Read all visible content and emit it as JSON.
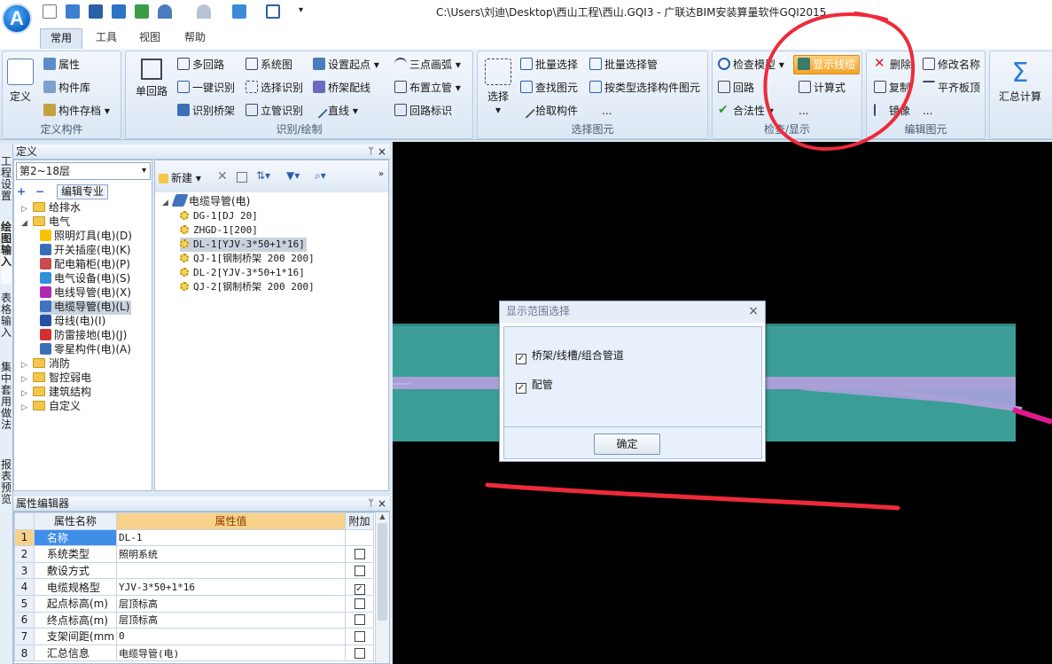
{
  "app": {
    "logo": "A",
    "title": "C:\\Users\\刘迪\\Desktop\\西山工程\\西山.GQI3 - 广联达BIM安装算量软件GQI2015"
  },
  "quick_access": {
    "overflow": "▾"
  },
  "tabs": [
    "常用",
    "工具",
    "视图",
    "帮助"
  ],
  "ribbon": {
    "define": {
      "group": "定义构件",
      "big": "定义",
      "items": [
        "属性",
        "构件库",
        "构件存档"
      ]
    },
    "draw": {
      "group": "识别/绘制",
      "big": "单回路",
      "col1": [
        "多回路",
        "一键识别",
        "识别桥架"
      ],
      "col2": [
        "系统图",
        "选择识别",
        "立管识别"
      ],
      "col3": [
        "设置起点",
        "桥架配线",
        "直线"
      ],
      "col4": [
        "三点画弧",
        "布置立管",
        "回路标识"
      ]
    },
    "select": {
      "group": "选择图元",
      "big": "选择",
      "col1": [
        "批量选择",
        "查找图元",
        "拾取构件"
      ],
      "col2": [
        "批量选择管",
        "按类型选择构件图元"
      ],
      "more": "..."
    },
    "check": {
      "group": "检查/显示",
      "col1": [
        "检查模型",
        "回路",
        "合法性"
      ],
      "col2": [
        "显示线缆",
        "计算式"
      ],
      "more": "..."
    },
    "edit": {
      "group": "编辑图元",
      "col1": [
        "删除",
        "复制",
        "镜像"
      ],
      "col2": [
        "修改名称",
        "平齐板顶"
      ],
      "more": "..."
    },
    "sum": {
      "big": "汇总计算"
    }
  },
  "vtabs": [
    "工程设置",
    "绘图输入",
    "表格输入",
    "集中套用做法",
    "报表预览"
  ],
  "define_panel": {
    "title": "定义",
    "floor": "第2~18层",
    "edit_major": "编辑专业",
    "tree": [
      {
        "label": "给排水",
        "level": 0,
        "type": "folder",
        "exp": "▷"
      },
      {
        "label": "电气",
        "level": 0,
        "type": "folder",
        "exp": "◢"
      },
      {
        "label": "照明灯具(电)(D)",
        "level": 1,
        "type": "item",
        "color": "#f5c400"
      },
      {
        "label": "开关插座(电)(K)",
        "level": 1,
        "type": "item",
        "color": "#3a6fb8"
      },
      {
        "label": "配电箱柜(电)(P)",
        "level": 1,
        "type": "item",
        "color": "#c94b4b"
      },
      {
        "label": "电气设备(电)(S)",
        "level": 1,
        "type": "item",
        "color": "#2f8fd8"
      },
      {
        "label": "电线导管(电)(X)",
        "level": 1,
        "type": "item",
        "color": "#b02ab0"
      },
      {
        "label": "电缆导管(电)(L)",
        "level": 1,
        "type": "item",
        "color": "#3f73c0",
        "selected": true
      },
      {
        "label": "母线(电)(I)",
        "level": 1,
        "type": "item",
        "color": "#2450a8"
      },
      {
        "label": "防雷接地(电)(J)",
        "level": 1,
        "type": "item",
        "color": "#d03030"
      },
      {
        "label": "零星构件(电)(A)",
        "level": 1,
        "type": "item",
        "color": "#3a6fb8"
      },
      {
        "label": "消防",
        "level": 0,
        "type": "folder",
        "exp": "▷"
      },
      {
        "label": "智控弱电",
        "level": 0,
        "type": "folder",
        "exp": "▷"
      },
      {
        "label": "建筑结构",
        "level": 0,
        "type": "folder",
        "exp": "▷"
      },
      {
        "label": "自定义",
        "level": 0,
        "type": "folder",
        "exp": "▷"
      }
    ]
  },
  "component_panel": {
    "new_label": "新建",
    "root": "电缆导管(电)",
    "items": [
      {
        "label": "DG-1[DJ 20]"
      },
      {
        "label": "ZHGD-1[200]"
      },
      {
        "label": "DL-1[YJV-3*50+1*16]",
        "selected": true
      },
      {
        "label": "QJ-1[钢制桥架 200 200]"
      },
      {
        "label": "DL-2[YJV-3*50+1*16]"
      },
      {
        "label": "QJ-2[钢制桥架 200 200]"
      }
    ]
  },
  "property_editor": {
    "title": "属性编辑器",
    "headers": [
      "属性名称",
      "属性值",
      "附加"
    ],
    "rows": [
      {
        "n": "1",
        "name": "名称",
        "value": "DL-1",
        "check": null
      },
      {
        "n": "2",
        "name": "系统类型",
        "value": "照明系统",
        "check": false
      },
      {
        "n": "3",
        "name": "敷设方式",
        "value": "",
        "check": false
      },
      {
        "n": "4",
        "name": "电缆规格型",
        "value": "YJV-3*50+1*16",
        "check": true
      },
      {
        "n": "5",
        "name": "起点标高(m)",
        "value": "层顶标高",
        "check": false
      },
      {
        "n": "6",
        "name": "终点标高(m)",
        "value": "层顶标高",
        "check": false
      },
      {
        "n": "7",
        "name": "支架间距(mm",
        "value": "0",
        "check": false
      },
      {
        "n": "8",
        "name": "汇总信息",
        "value": "电缆导管(电)",
        "check": false
      }
    ]
  },
  "dialog": {
    "title": "显示范围选择",
    "close": "×",
    "options": [
      {
        "label": "桥架/线槽/组合管道",
        "checked": true
      },
      {
        "label": "配管",
        "checked": true
      }
    ],
    "ok": "确定"
  },
  "colors": {
    "canvas": "#000000",
    "tray": "#3a9e96",
    "pipe": "#a9a0d8",
    "magenta": "#e0188f",
    "annotation": "#ee2a3a",
    "highlight": "#f6a11a"
  }
}
